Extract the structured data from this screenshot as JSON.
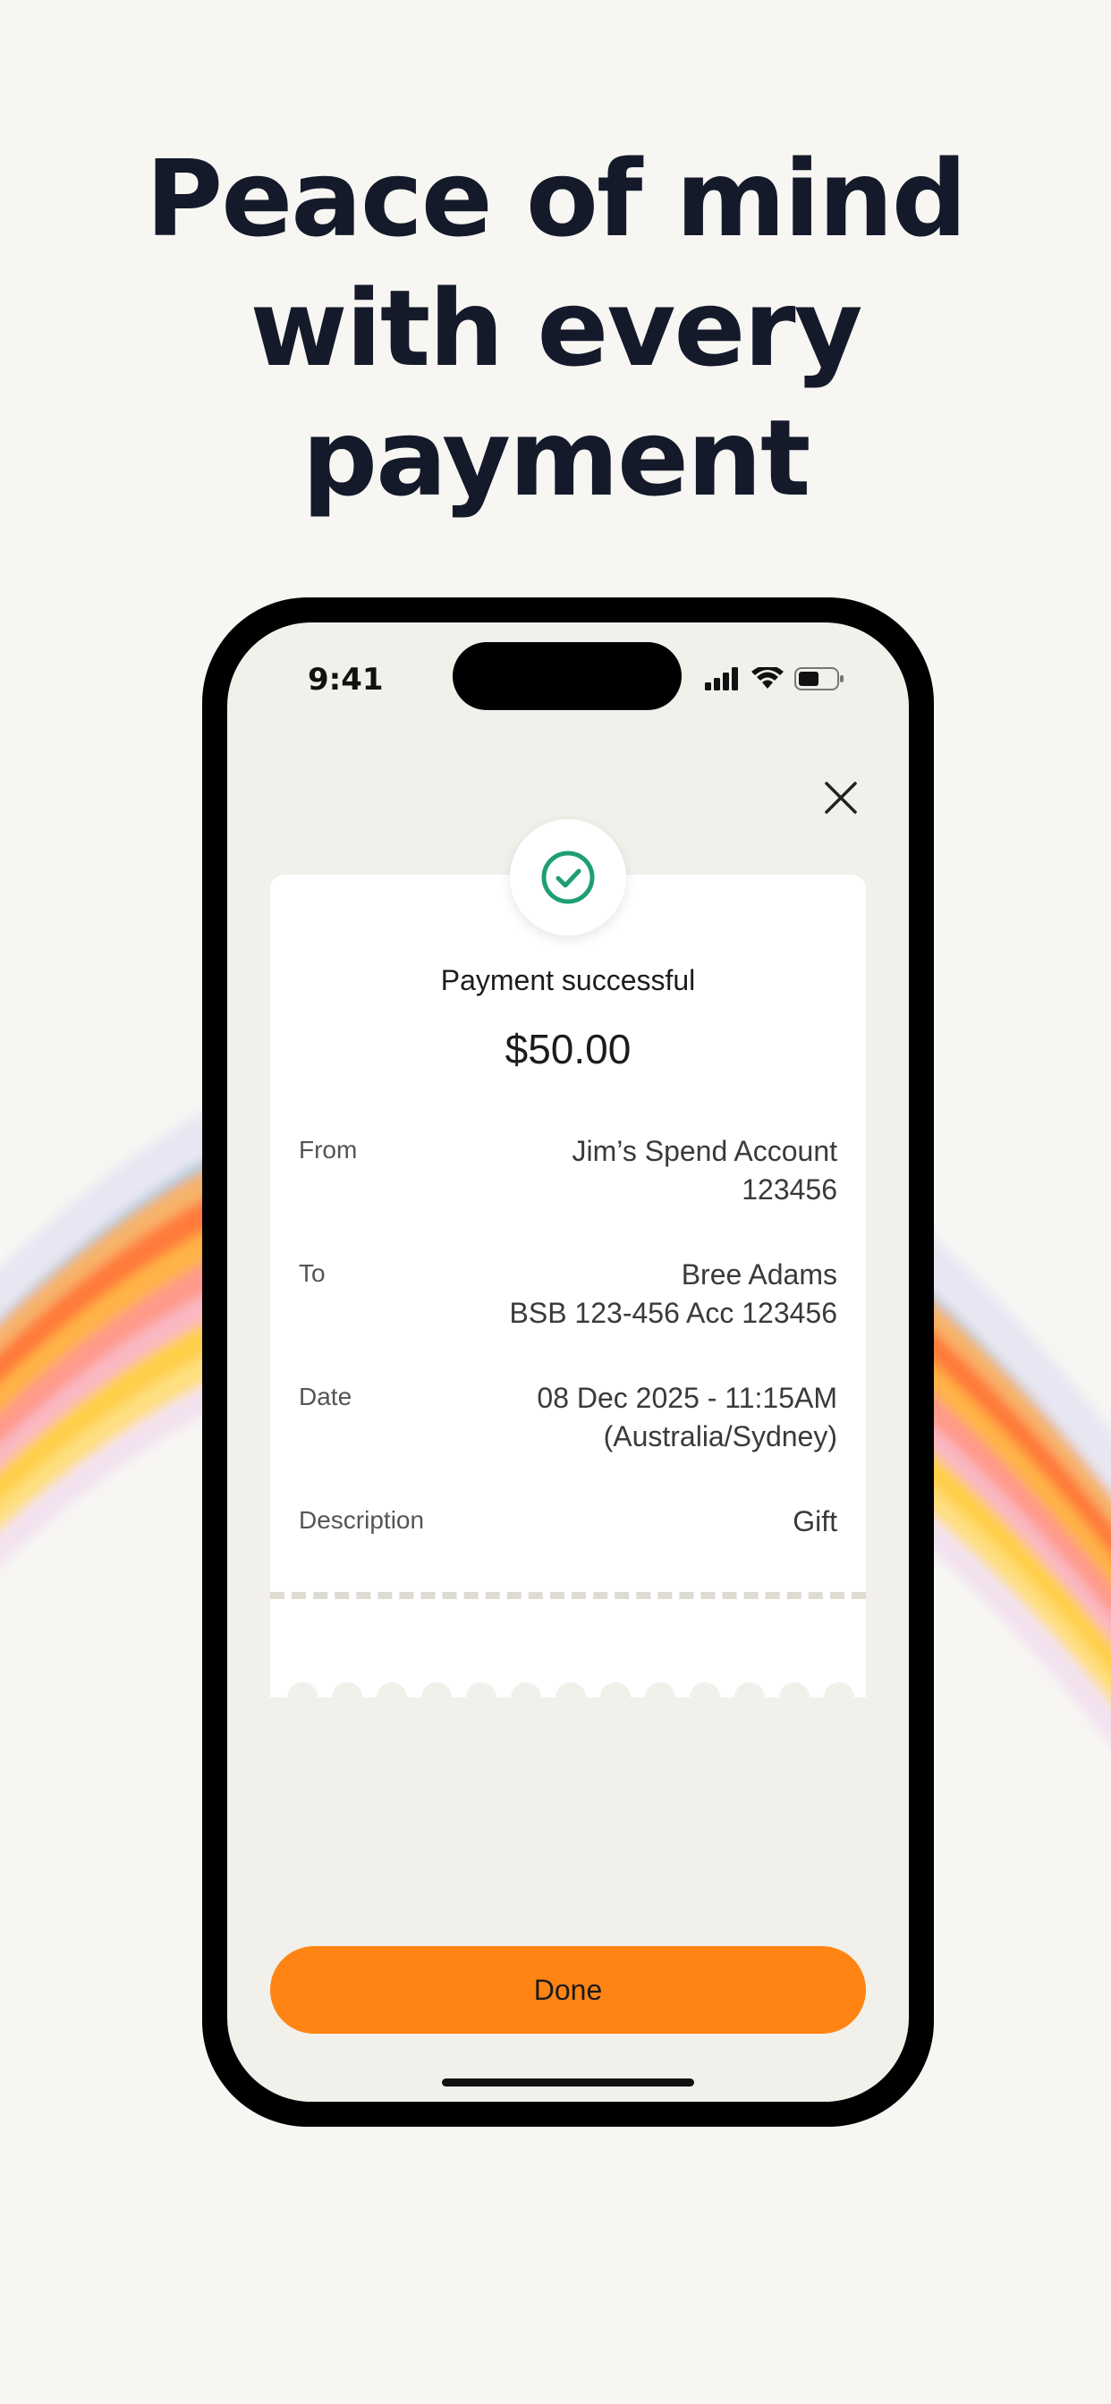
{
  "headline": {
    "line1": "Peace of mind",
    "line2": "with every",
    "line3": "payment"
  },
  "status_bar": {
    "time": "9:41"
  },
  "receipt": {
    "title": "Payment successful",
    "amount": "$50.00",
    "from": {
      "label": "From",
      "line1": "Jim’s Spend Account",
      "line2": "123456"
    },
    "to": {
      "label": "To",
      "line1": "Bree Adams",
      "line2": "BSB 123-456 Acc 123456"
    },
    "date": {
      "label": "Date",
      "line1": "08 Dec 2025 - 11:15AM",
      "line2": "(Australia/Sydney)"
    },
    "description": {
      "label": "Description",
      "value": "Gift"
    }
  },
  "actions": {
    "done_label": "Done"
  },
  "icons": {
    "close": "close-icon",
    "success": "check-circle-icon",
    "signal": "signal-icon",
    "wifi": "wifi-icon",
    "battery": "battery-icon"
  },
  "colors": {
    "accent": "#ff8413",
    "success": "#1e9e74",
    "headline": "#141a2a",
    "background": "#f7f6f3",
    "screen": "#f2f0eb"
  }
}
